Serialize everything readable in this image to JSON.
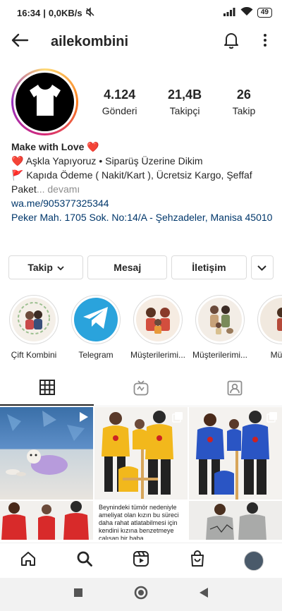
{
  "status": {
    "time": "16:34",
    "network_speed": "0,0KB/s",
    "battery": "49"
  },
  "header": {
    "username": "ailekombini"
  },
  "profile": {
    "stats": [
      {
        "value": "4.124",
        "label": "Gönderi"
      },
      {
        "value": "21,4B",
        "label": "Takipçi"
      },
      {
        "value": "26",
        "label": "Takip"
      }
    ]
  },
  "bio": {
    "name": "Make with Love",
    "name_emoji": "❤️",
    "line1_emoji": "❤️",
    "line1": "Aşkla Yapıyoruz • Siparüş Üzerine Dikim",
    "line2_emoji": "🚩",
    "line2": "Kapıda Ödeme ( Nakit/Kart ), Ücretsiz Kargo, Şeffaf Paket",
    "more": "... devamı",
    "link": "wa.me/905377325344",
    "address": "Peker Mah. 1705 Sok. No:14/A - Şehzadeler, Manisa 45010"
  },
  "actions": {
    "follow": "Takip",
    "message": "Mesaj",
    "contact": "İletişim"
  },
  "highlights": [
    {
      "label": "Çift Kombini"
    },
    {
      "label": "Telegram"
    },
    {
      "label": "Müşterilerimi..."
    },
    {
      "label": "Müşterilerimi..."
    },
    {
      "label": "Müşte"
    }
  ],
  "grid": {
    "caption": "Beynindeki tümör nedeniyle ameliyat olan kızın bu süreci daha rahat atlatabilmesi için kendini kızına benzetmeye çalışan bir baba"
  },
  "colors": {
    "accent_link": "#00376b",
    "telegram": "#2aa3dc",
    "text": "#262626"
  }
}
